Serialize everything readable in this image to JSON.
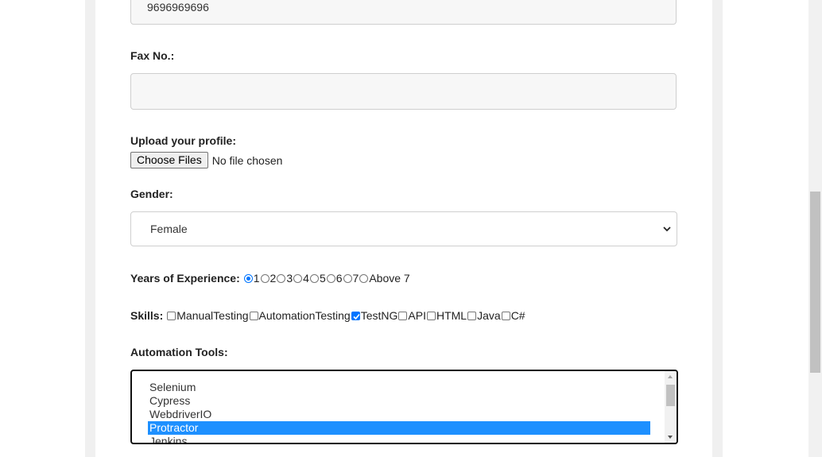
{
  "form": {
    "phone": {
      "value": "9696969696"
    },
    "fax": {
      "label": "Fax No.:",
      "value": ""
    },
    "upload": {
      "label": "Upload your profile:",
      "button_label": "Choose Files",
      "status": "No file chosen"
    },
    "gender": {
      "label": "Gender:",
      "selected": "Female"
    },
    "experience": {
      "label": "Years of Experience:",
      "options": [
        "1",
        "2",
        "3",
        "4",
        "5",
        "6",
        "7",
        "Above 7"
      ],
      "selected": "1"
    },
    "skills": {
      "label": "Skills:",
      "options": [
        "ManualTesting",
        "AutomationTesting",
        "TestNG",
        "API",
        "HTML",
        "Java",
        "C#"
      ],
      "checked": [
        "TestNG"
      ]
    },
    "automation_tools": {
      "label": "Automation Tools:",
      "options": [
        "Selenium",
        "Cypress",
        "WebdriverIO",
        "Protractor",
        "Jenkins"
      ],
      "selected": "Protractor"
    }
  },
  "colors": {
    "accent": "#0075ff",
    "selection": "#1e90ff",
    "band": "#f0f0f0"
  }
}
